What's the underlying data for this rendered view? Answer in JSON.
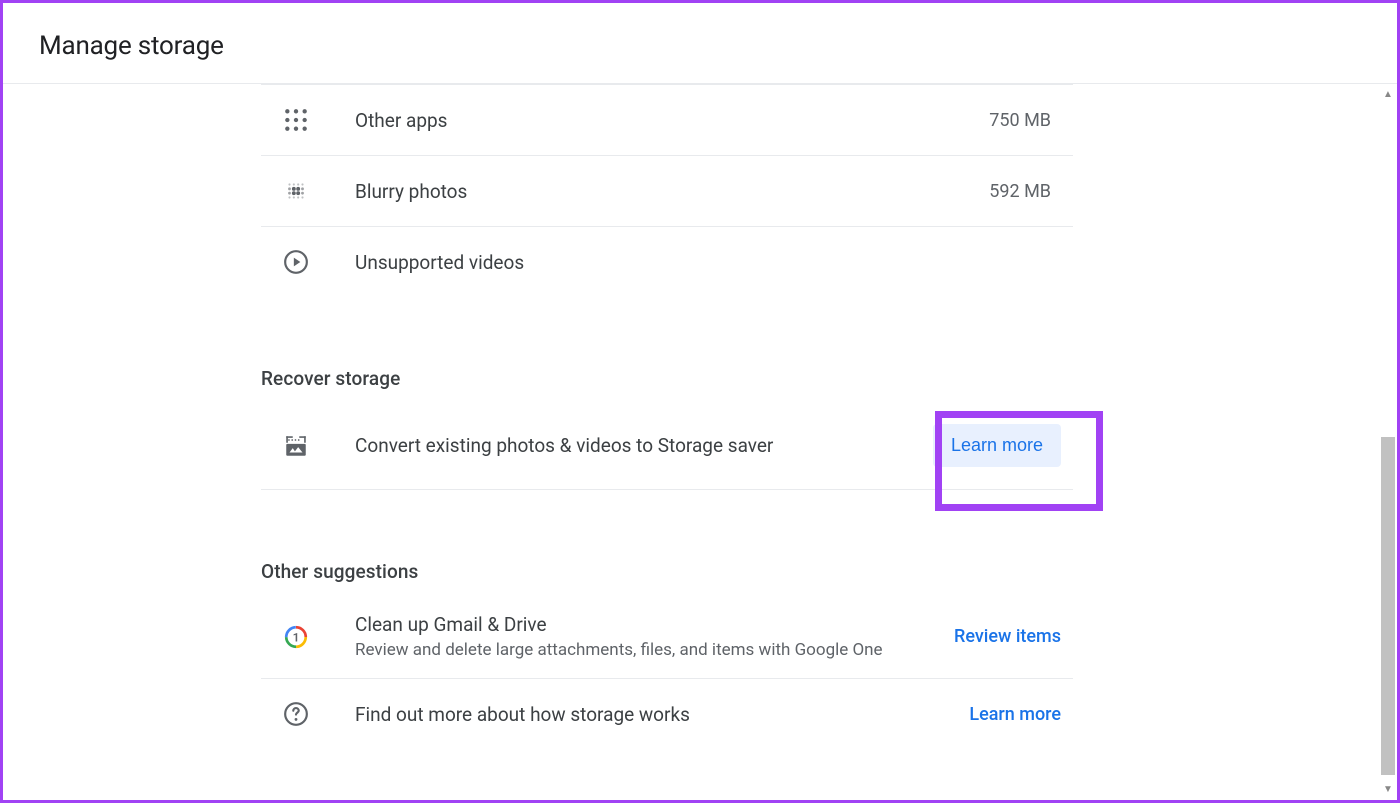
{
  "header": {
    "title": "Manage storage"
  },
  "storage_items": [
    {
      "label": "Other apps",
      "value": "750 MB"
    },
    {
      "label": "Blurry photos",
      "value": "592 MB"
    },
    {
      "label": "Unsupported videos",
      "value": ""
    }
  ],
  "recover": {
    "title": "Recover storage",
    "convert_label": "Convert existing photos & videos to Storage saver",
    "learn_more": "Learn more"
  },
  "suggestions": {
    "title": "Other suggestions",
    "cleanup_title": "Clean up Gmail & Drive",
    "cleanup_subtitle": "Review and delete large attachments, files, and items with Google One",
    "review_items": "Review items",
    "how_storage_works": "Find out more about how storage works",
    "learn_more": "Learn more"
  }
}
